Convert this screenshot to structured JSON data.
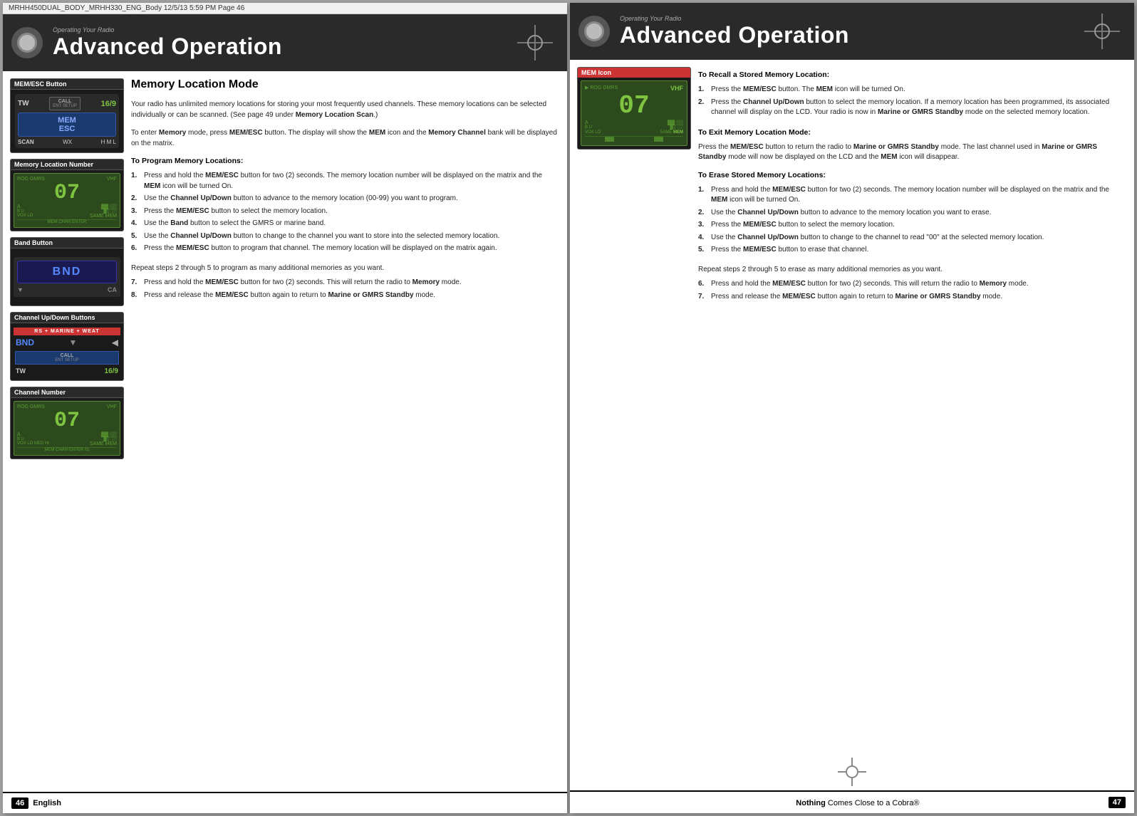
{
  "file_info": {
    "filename": "MRHH450DUAL_BODY_MRHH330_ENG_Body  12/5/13  5:59 PM  Page 46"
  },
  "page_left": {
    "header": {
      "subtitle": "Operating Your Radio",
      "title": "Advanced Operation"
    },
    "section_title": "Memory Location Mode",
    "intro_text": "Your radio has unlimited memory locations for storing your most frequently used channels. These memory locations can be selected individually or can be scanned. (See page 49 under Memory Location Scan.)",
    "enter_memory_text": "To enter Memory mode, press MEM/ESC button. The display will show the MEM icon and the Memory Channel bank will be displayed on the matrix.",
    "program_heading": "To Program Memory Locations:",
    "steps": [
      {
        "num": "1.",
        "text": "Press and hold the MEM/ESC button for two (2) seconds. The memory location number will be displayed on the matrix and the MEM icon will be turned On."
      },
      {
        "num": "2.",
        "text": "Use the Channel Up/Down button to advance to the memory location (00-99) you want to program."
      },
      {
        "num": "3.",
        "text": "Press the MEM/ESC button to select the memory location."
      },
      {
        "num": "4.",
        "text": "Use the Band button to select the GMRS or marine band."
      },
      {
        "num": "5.",
        "text": "Use the Channel Up/Down button to change to the channel you want to store into the selected memory location."
      },
      {
        "num": "6.",
        "text": "Press the MEM/ESC button to program that channel. The memory location will be displayed on the matrix again."
      }
    ],
    "repeat_text": "Repeat steps 2 through 5 to program as many additional memories as you want.",
    "steps_cont": [
      {
        "num": "7.",
        "text": "Press and hold the MEM/ESC button for two (2) seconds. This will return the radio to Memory mode."
      },
      {
        "num": "8.",
        "text": "Press and release the MEM/ESC button again to return to Marine or GMRS Standby mode."
      }
    ],
    "device_labels": {
      "mem_esc_button": "MEM/ESC Button",
      "memory_location_number": "Memory Location Number",
      "band_button": "Band Button",
      "channel_updown_buttons": "Channel Up/Down Buttons",
      "channel_number": "Channel Number"
    },
    "lcd_values": {
      "big_num": "16/9",
      "big_num2": "07",
      "big_num3": "07",
      "bnd_label": "BND",
      "ch_bar": "RS + MARINE + WEAT"
    },
    "footer": {
      "page_num": "46",
      "lang": "English"
    }
  },
  "page_right": {
    "header": {
      "subtitle": "Operating Your Radio",
      "title": "Advanced Operation"
    },
    "mem_icon_label": "MEM Icon",
    "recall_heading": "To Recall a Stored Memory Location:",
    "recall_steps": [
      {
        "num": "1.",
        "text": "Press the MEM/ESC button. The MEM icon will be turned On."
      },
      {
        "num": "2.",
        "text": "Press the Channel Up/Down button to select the memory location. If a memory location has been programmed, its associated channel will display on the LCD. Your radio is now in Marine or GMRS Standby mode on the selected memory location."
      }
    ],
    "exit_heading": "To Exit Memory Location Mode:",
    "exit_text": "Press the MEM/ESC button to return the radio to Marine or GMRS Standby mode. The last channel used in Marine or GMRS Standby mode will now be displayed on the LCD and the MEM icon will disappear.",
    "erase_heading": "To Erase Stored Memory Locations:",
    "erase_steps": [
      {
        "num": "1.",
        "text": "Press and hold the MEM/ESC button for two (2) seconds. The memory location number will be displayed on the matrix and the MEM icon will be turned On."
      },
      {
        "num": "2.",
        "text": "Use the Channel Up/Down button to advance to the memory location you want to erase."
      },
      {
        "num": "3.",
        "text": "Press the MEM/ESC button to select the memory location."
      },
      {
        "num": "4.",
        "text": "Use the Channel Up/Down button to change to the channel to read \"00\" at the selected memory location."
      },
      {
        "num": "5.",
        "text": "Press the MEM/ESC button to erase that channel."
      }
    ],
    "repeat_text": "Repeat steps 2 through 5 to erase as many additional memories as you want.",
    "steps_cont": [
      {
        "num": "6.",
        "text": "Press and hold the MEM/ESC button for two (2) seconds. This will return the radio to Memory mode."
      },
      {
        "num": "7.",
        "text": "Press and release the MEM/ESC button again to return to Marine or GMRS Standby mode."
      }
    ],
    "footer": {
      "page_num": "47",
      "tagline_nothing": "Nothing",
      "tagline_rest": "Comes Close to a Cobra"
    }
  },
  "colors": {
    "header_bg": "#1a1a1a",
    "header_title": "#ffffff",
    "accent_red": "#cc3333",
    "lcd_green": "#7fc441",
    "lcd_bg": "#2d4a1e"
  }
}
